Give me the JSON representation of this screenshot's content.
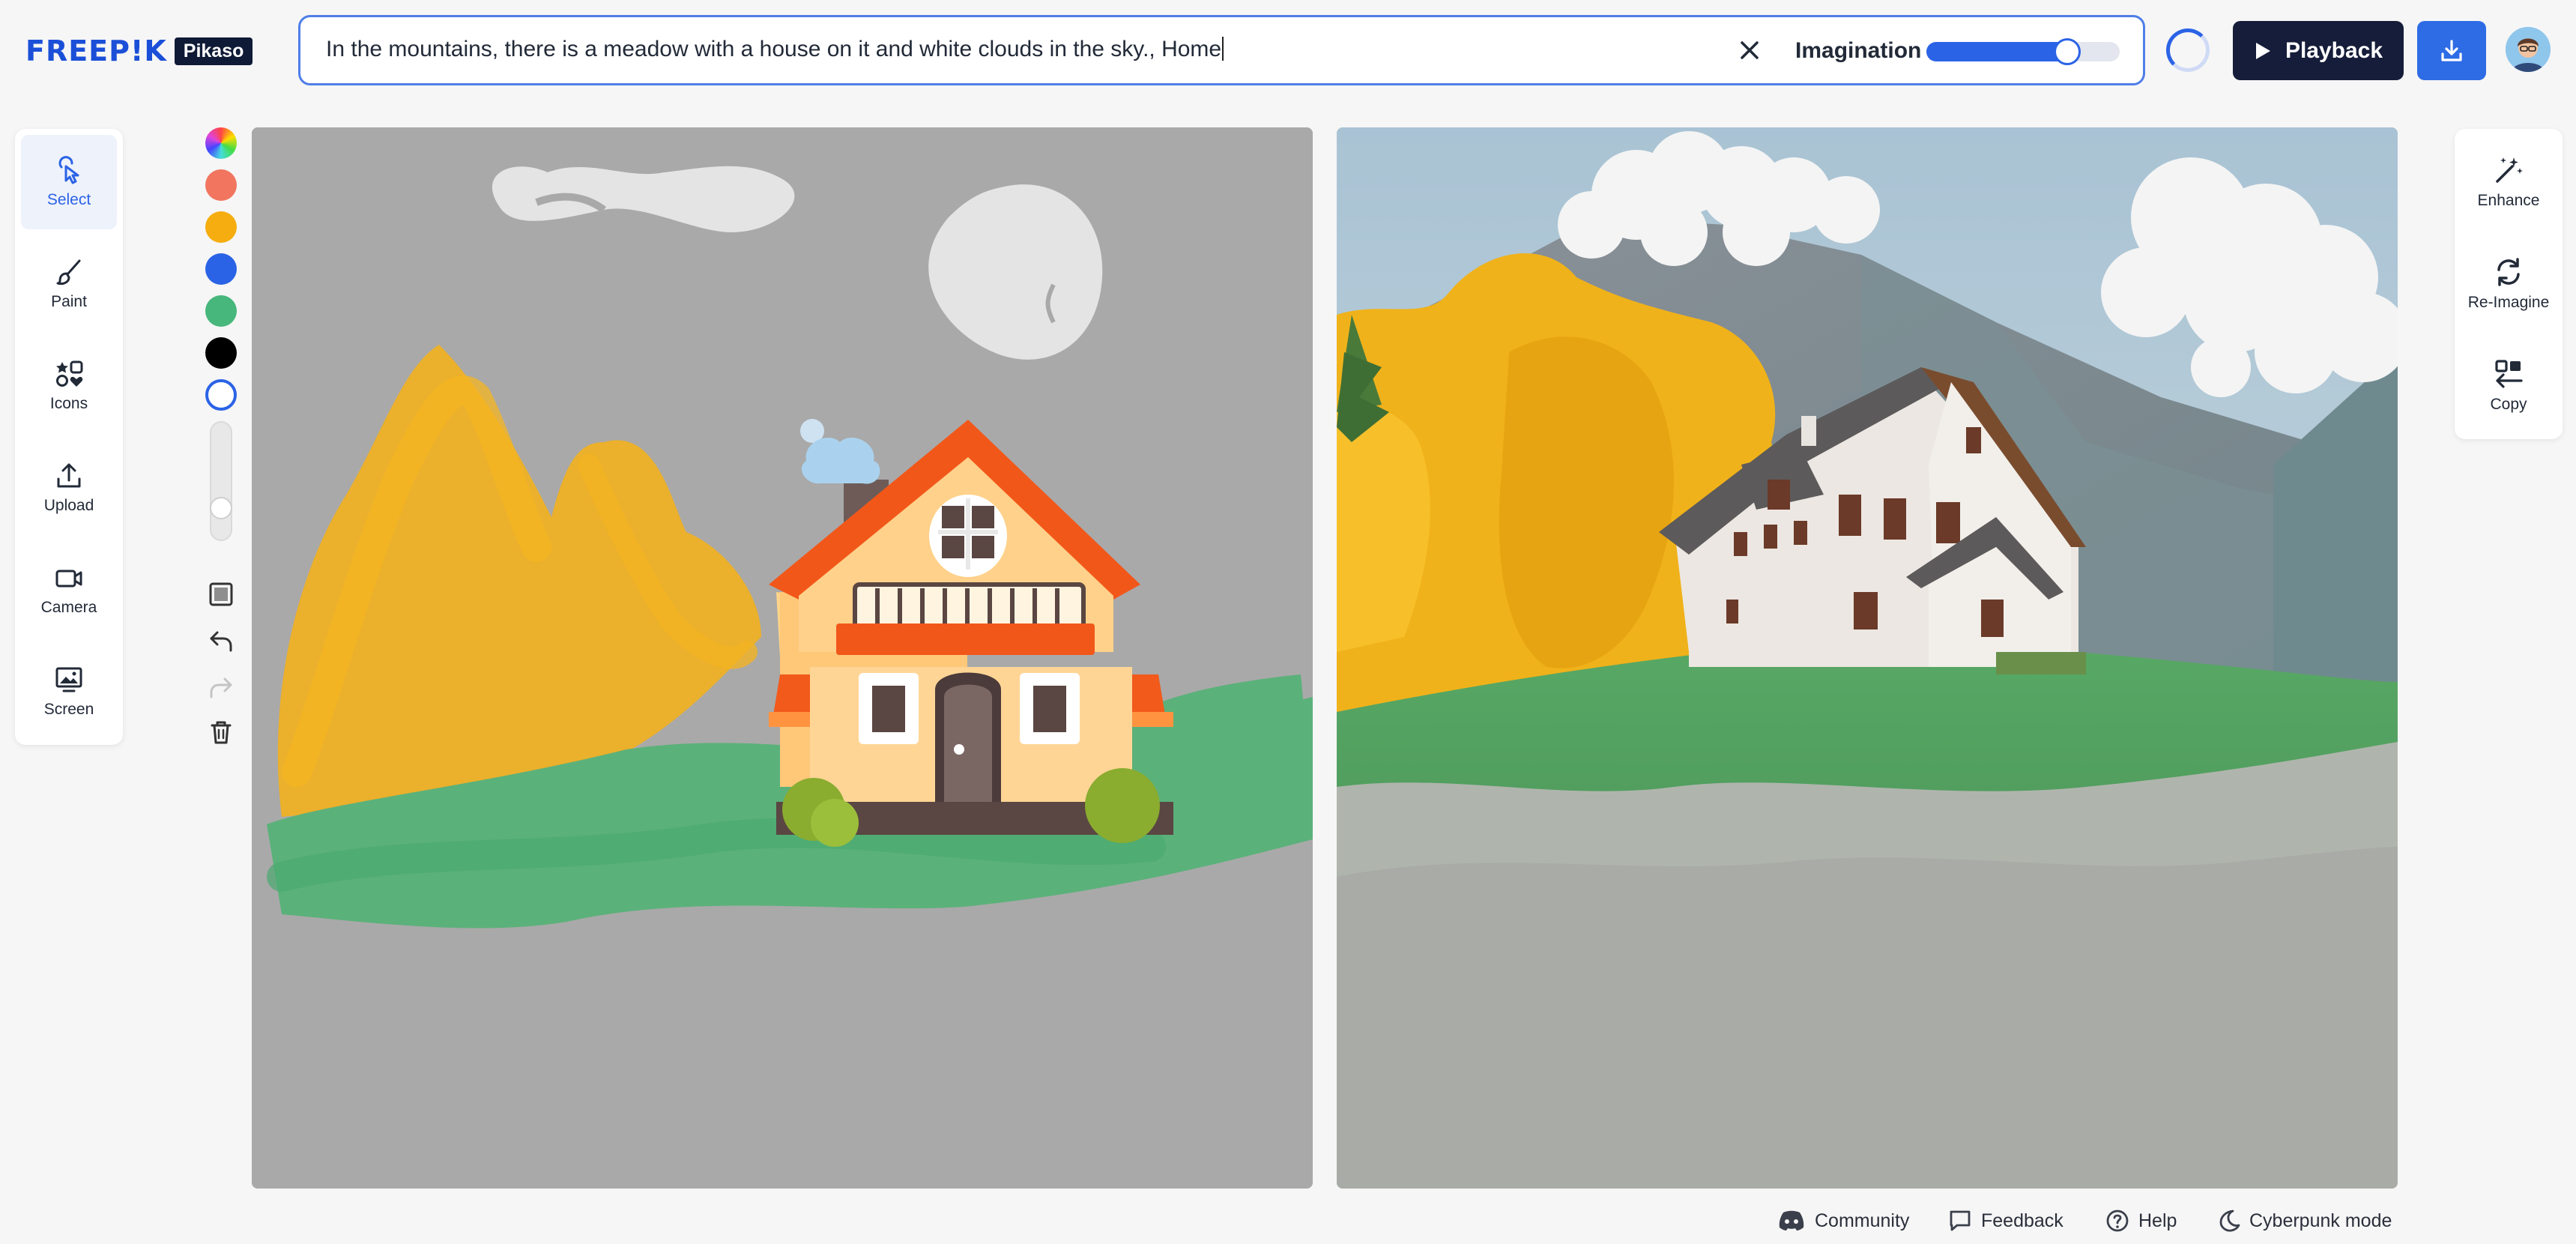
{
  "header": {
    "logo_text": "FREEP!K",
    "logo_badge": "Pikaso",
    "prompt_text": "In the mountains, there is a meadow with a house on it and white clouds in the sky., Home",
    "imagination_label": "Imagination",
    "imagination_level": 0.73,
    "playback_label": "Playback"
  },
  "left_toolbar": {
    "items": [
      {
        "label": "Select",
        "icon": "cursor-click-icon"
      },
      {
        "label": "Paint",
        "icon": "brush-icon"
      },
      {
        "label": "Icons",
        "icon": "shapes-icon"
      },
      {
        "label": "Upload",
        "icon": "upload-icon"
      },
      {
        "label": "Camera",
        "icon": "camera-icon"
      },
      {
        "label": "Screen",
        "icon": "screen-icon"
      }
    ]
  },
  "right_toolbar": {
    "items": [
      {
        "label": "Enhance",
        "icon": "magic-wand-icon"
      },
      {
        "label": "Re-Imagine",
        "icon": "refresh-icon"
      },
      {
        "label": "Copy",
        "icon": "copy-icon"
      }
    ]
  },
  "palette": {
    "colors": [
      "#f1755f",
      "#f5ad0f",
      "#2b63e6",
      "#47b77c",
      "#000000",
      "#ffffff"
    ],
    "brush_size": 0.3
  },
  "footer": {
    "community": "Community",
    "feedback": "Feedback",
    "help": "Help",
    "cyberpunk": "Cyberpunk mode"
  },
  "colors": {
    "accent": "#2b63e6",
    "dark": "#151d3a",
    "canvas_gray": "#a9a9a9"
  }
}
